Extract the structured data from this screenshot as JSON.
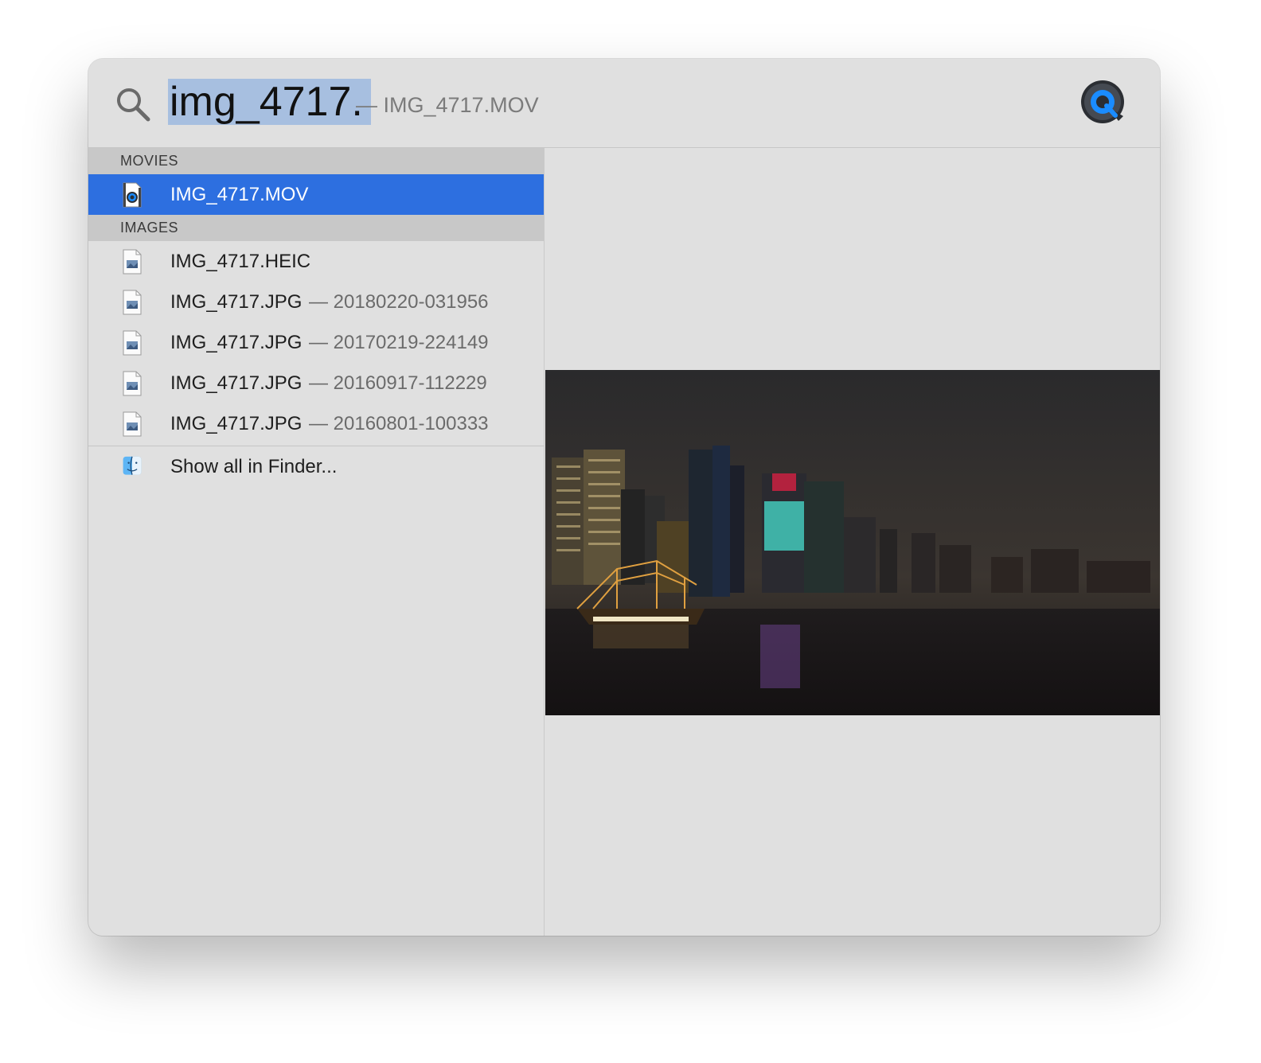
{
  "search": {
    "query": "img_4717.",
    "completion": "— IMG_4717.MOV"
  },
  "top_hit_app_icon": "quicktime-player-icon",
  "sections": {
    "movies": {
      "header": "MOVIES",
      "items": [
        {
          "name": "IMG_4717.MOV",
          "sub": "",
          "icon": "movie-file-icon",
          "selected": true
        }
      ]
    },
    "images": {
      "header": "IMAGES",
      "items": [
        {
          "name": "IMG_4717.HEIC",
          "sub": "",
          "icon": "image-file-icon"
        },
        {
          "name": "IMG_4717.JPG",
          "sub": "— 20180220-031956",
          "icon": "image-file-icon"
        },
        {
          "name": "IMG_4717.JPG",
          "sub": "— 20170219-224149",
          "icon": "image-file-icon"
        },
        {
          "name": "IMG_4717.JPG",
          "sub": "— 20160917-112229",
          "icon": "image-file-icon"
        },
        {
          "name": "IMG_4717.JPG",
          "sub": "— 20160801-100333",
          "icon": "image-file-icon"
        }
      ]
    }
  },
  "show_all": {
    "label": "Show all in Finder...",
    "icon": "finder-icon"
  },
  "colors": {
    "selection": "#2d6fe0",
    "query_highlight": "#a7bfe0",
    "panel": "#e0e0e0"
  }
}
